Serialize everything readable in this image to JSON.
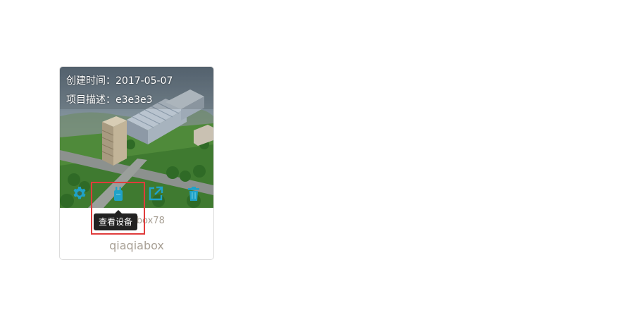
{
  "project_card": {
    "created_label": "创建时间：2017-05-07",
    "description_label": "项目描述：e3e3e3",
    "subtitle": "qiaqiabox78",
    "title": "qiaqiabox",
    "image_alt": "aerial view of factory campus",
    "actions": {
      "settings_icon": "gear-icon",
      "devices_icon": "device-icon",
      "open_icon": "external-link-icon",
      "delete_icon": "trash-icon"
    }
  },
  "tooltip": {
    "text": "查看设备"
  },
  "colors": {
    "icon_accent": "#1fa2c8",
    "muted_text": "#a8a095",
    "tooltip_bg": "#222222",
    "highlight": "#e03c3c"
  }
}
